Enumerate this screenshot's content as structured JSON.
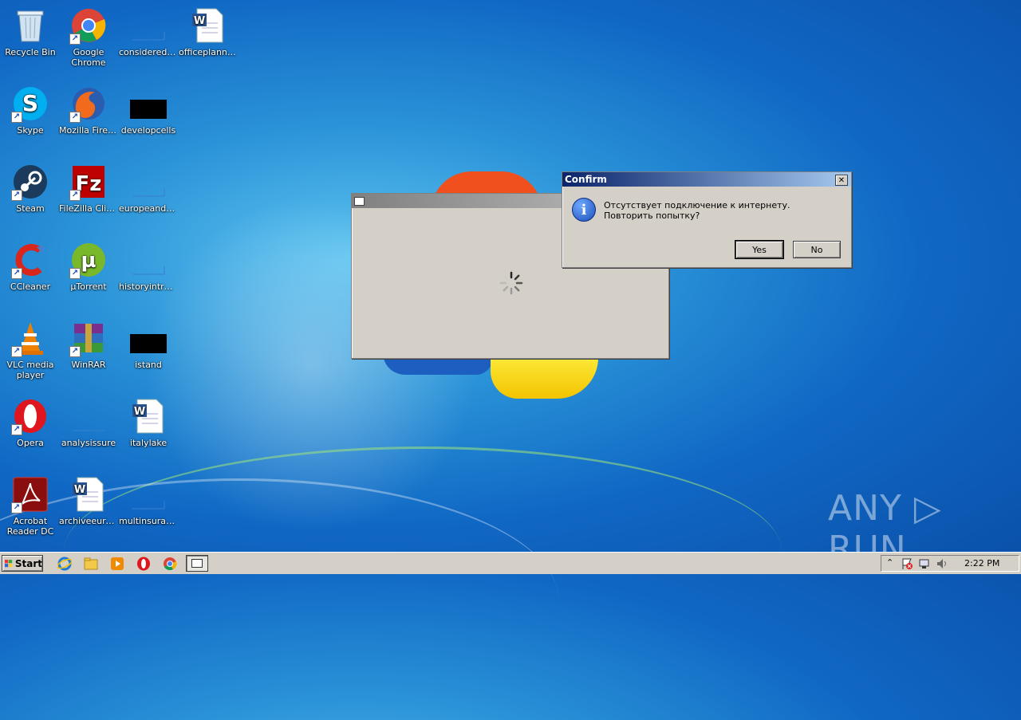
{
  "desktop": {
    "icons": [
      {
        "label": "Recycle Bin",
        "name": "recycle-bin"
      },
      {
        "label": "Google Chrome",
        "name": "google-chrome"
      },
      {
        "label": "consideredt…",
        "name": "considered-file"
      },
      {
        "label": "officeplanning",
        "name": "officeplanning"
      },
      {
        "label": "Skype",
        "name": "skype"
      },
      {
        "label": "Mozilla Firefox",
        "name": "mozilla-firefox"
      },
      {
        "label": "developcells",
        "name": "developcells"
      },
      {
        "label": "Steam",
        "name": "steam"
      },
      {
        "label": "FileZilla Client",
        "name": "filezilla"
      },
      {
        "label": "europeandebt",
        "name": "europeandebt"
      },
      {
        "label": "CCleaner",
        "name": "ccleaner"
      },
      {
        "label": "µTorrent",
        "name": "utorrent"
      },
      {
        "label": "historyintro…",
        "name": "historyintro"
      },
      {
        "label": "VLC media player",
        "name": "vlc"
      },
      {
        "label": "WinRAR",
        "name": "winrar"
      },
      {
        "label": "istand",
        "name": "istand"
      },
      {
        "label": "Opera",
        "name": "opera"
      },
      {
        "label": "analysissure",
        "name": "analysissure"
      },
      {
        "label": "italylake",
        "name": "italylake"
      },
      {
        "label": "Acrobat Reader DC",
        "name": "acrobat"
      },
      {
        "label": "archiveeurope",
        "name": "archiveeurope"
      },
      {
        "label": "multinsurance",
        "name": "multinsurance"
      }
    ]
  },
  "confirm_dialog": {
    "title": "Confirm",
    "message": "Отсутствует подключение к интернету. Повторить попытку?",
    "yes_label": "Yes",
    "no_label": "No",
    "close_glyph": "✕",
    "info_glyph": "i"
  },
  "taskbar": {
    "start_label": "Start",
    "clock": "2:22 PM"
  },
  "watermark": "ANY ▷ RUN",
  "colors": {
    "titlebar_active": "#0a246a",
    "titlebar_active_end": "#a6caf0",
    "titlebar_inactive": "#808080"
  }
}
